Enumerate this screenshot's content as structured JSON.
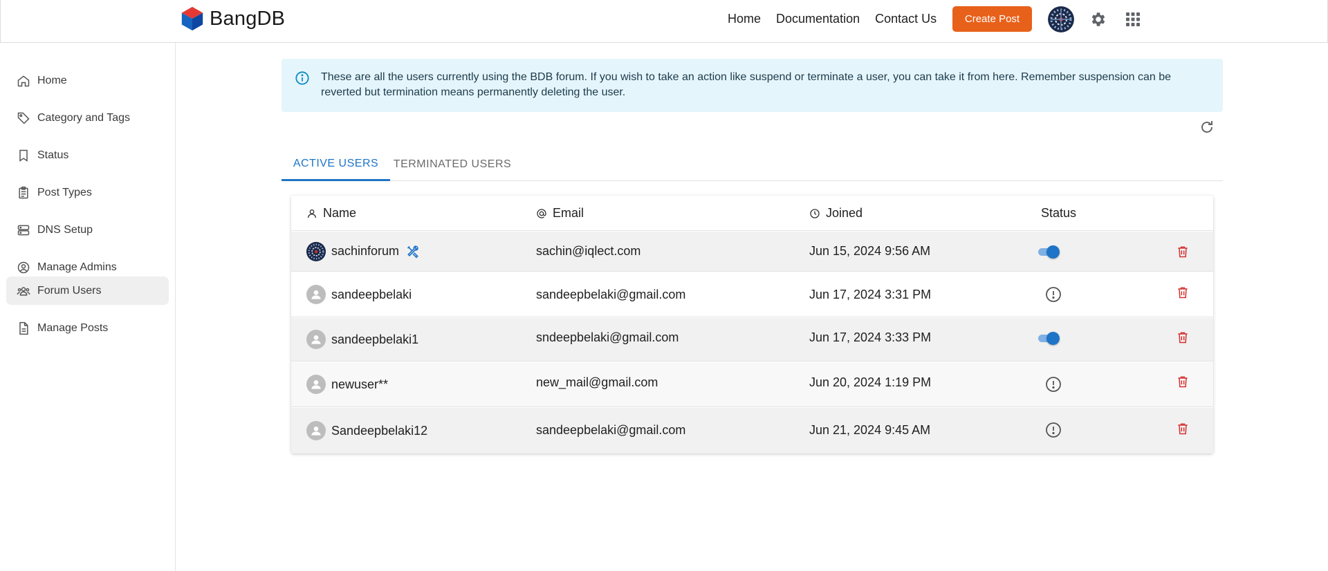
{
  "header": {
    "brand": "BangDB",
    "nav": [
      "Home",
      "Documentation",
      "Contact Us"
    ],
    "create_post": "Create Post"
  },
  "sidebar": {
    "items": [
      {
        "label": "Home",
        "icon": "home-icon"
      },
      {
        "label": "Category and Tags",
        "icon": "tag-icon"
      },
      {
        "label": "Status",
        "icon": "bookmark-icon"
      },
      {
        "label": "Post Types",
        "icon": "clipboard-icon"
      },
      {
        "label": "DNS Setup",
        "icon": "server-icon"
      },
      {
        "label": "Manage Admins",
        "icon": "user-circle-icon"
      },
      {
        "label": "Forum Users",
        "icon": "users-icon",
        "active": true
      },
      {
        "label": "Manage Posts",
        "icon": "file-icon"
      }
    ]
  },
  "alert": {
    "text": "These are all the users currently using the BDB forum. If you wish to take an action like suspend or terminate a user, you can take it from here. Remember suspension can be reverted but termination means permanently deleting the user."
  },
  "tabs": {
    "active": "ACTIVE USERS",
    "inactive": "TERMINATED USERS"
  },
  "table": {
    "columns": {
      "name": "Name",
      "email": "Email",
      "joined": "Joined",
      "status": "Status"
    },
    "rows": [
      {
        "name": "sachinforum",
        "email": "sachin@iqlect.com",
        "joined": "Jun 15, 2024 9:56 AM",
        "status": "active",
        "admin": true
      },
      {
        "name": "sandeepbelaki",
        "email": "sandeepbelaki@gmail.com",
        "joined": "Jun 17, 2024 3:31 PM",
        "status": "suspended"
      },
      {
        "name": "sandeepbelaki1",
        "email": "sndeepbelaki@gmail.com",
        "joined": "Jun 17, 2024 3:33 PM",
        "status": "active"
      },
      {
        "name": "newuser**",
        "email": "new_mail@gmail.com",
        "joined": "Jun 20, 2024 1:19 PM",
        "status": "suspended"
      },
      {
        "name": "Sandeepbelaki12",
        "email": "sandeepbelaki@gmail.com",
        "joined": "Jun 21, 2024 9:45 AM",
        "status": "suspended"
      }
    ]
  },
  "colors": {
    "accent": "#1e74c6",
    "create_post_bg": "#e8611a",
    "delete_icon": "#d32f2f",
    "alert_bg": "#e5f5fc"
  }
}
